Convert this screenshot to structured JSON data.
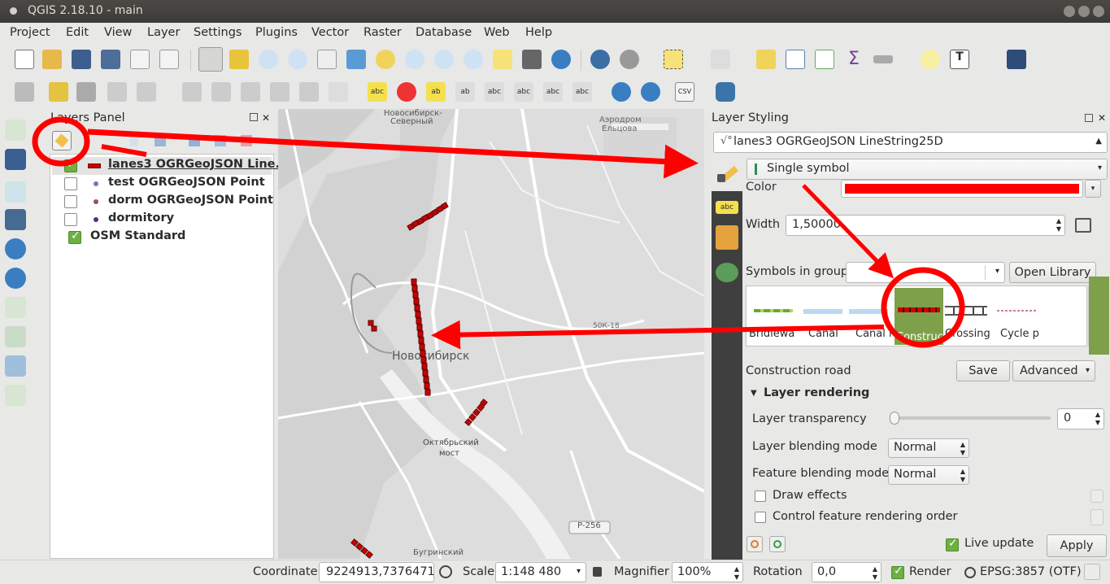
{
  "window": {
    "title": "QGIS 2.18.10 - main"
  },
  "menu": [
    "Project",
    "Edit",
    "View",
    "Layer",
    "Settings",
    "Plugins",
    "Vector",
    "Raster",
    "Database",
    "Web",
    "Help"
  ],
  "layers_panel": {
    "title": "Layers Panel",
    "layers": [
      {
        "name": "lanes3 OGRGeoJSON Line...",
        "checked": true,
        "icon": "line-dots-icon"
      },
      {
        "name": "test OGRGeoJSON Point",
        "checked": false,
        "icon": "point-icon"
      },
      {
        "name": "dorm OGRGeoJSON Point",
        "checked": false,
        "icon": "point-icon"
      },
      {
        "name": "dormitory",
        "checked": false,
        "icon": "point-icon"
      },
      {
        "name": "OSM Standard",
        "checked": true,
        "icon": ""
      }
    ]
  },
  "map": {
    "labels": {
      "north_a": "Новосибирск-",
      "north_b": "Северный",
      "airport_a": "Аэродром",
      "airport_b": "Ельцова",
      "city": "Новосибирск",
      "bridge_a": "Октябрьский",
      "bridge_b": "мост",
      "road": "Р-256",
      "district": "Бугринский",
      "road2": "50К-18"
    }
  },
  "styling": {
    "title": "Layer Styling",
    "layer_select": "lanes3 OGRGeoJSON LineString25D",
    "renderer": "Single symbol",
    "color_label": "Color",
    "color_value": "#ff0000",
    "width_label": "Width",
    "width_value": "1,50000",
    "symbols_group_label": "Symbols in group",
    "open_library": "Open Library",
    "symbols": [
      "Bridlewa",
      "Canal",
      "Canal i",
      "Construc",
      "Crossing",
      "Cycle p"
    ],
    "selected_symbol_name": "Construction road",
    "save": "Save",
    "advanced": "Advanced",
    "layer_rendering": "Layer rendering",
    "transparency_label": "Layer transparency",
    "transparency_value": "0",
    "blend_label": "Layer blending mode",
    "blend_value": "Normal",
    "feature_blend_label": "Feature blending mode",
    "feature_blend_value": "Normal",
    "draw_effects": "Draw effects",
    "control_order": "Control feature rendering order",
    "live_update": "Live update",
    "apply": "Apply"
  },
  "status": {
    "coordinate_label": "Coordinate",
    "coordinate_value": "9224913,7376471",
    "scale_label": "Scale",
    "scale_value": "1:148 480",
    "magnifier_label": "Magnifier",
    "magnifier_value": "100%",
    "rotation_label": "Rotation",
    "rotation_value": "0,0",
    "render_label": "Render",
    "crs": "EPSG:3857 (OTF)"
  },
  "colors": {
    "accent_red": "#ff0000",
    "selection_green": "#7ea04b",
    "check_green": "#6eb042"
  }
}
